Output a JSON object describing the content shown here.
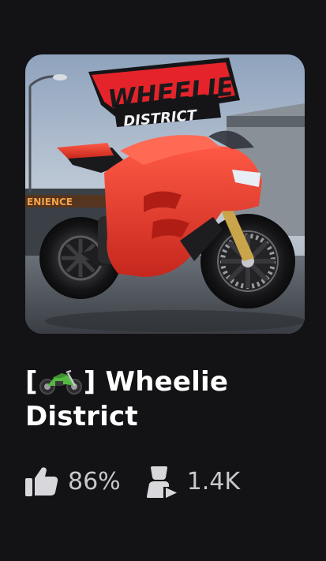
{
  "game": {
    "thumbnail": {
      "logo_line1": "WHEELIE",
      "logo_line2": "DISTRICT",
      "store_sign": "ENIENCE",
      "colors": {
        "bike": "#e8392a",
        "logo_red": "#e4242a",
        "sky": "#b9c6d6",
        "ground": "#4d5258"
      }
    },
    "title_prefix_open": "[",
    "title_prefix_icon": "motorcycle-emoji",
    "title_prefix_close": "]",
    "title_text": " Wheelie District",
    "stats": {
      "rating_icon": "thumbs-up-icon",
      "rating": "86%",
      "players_icon": "players-icon",
      "players": "1.4K"
    }
  }
}
